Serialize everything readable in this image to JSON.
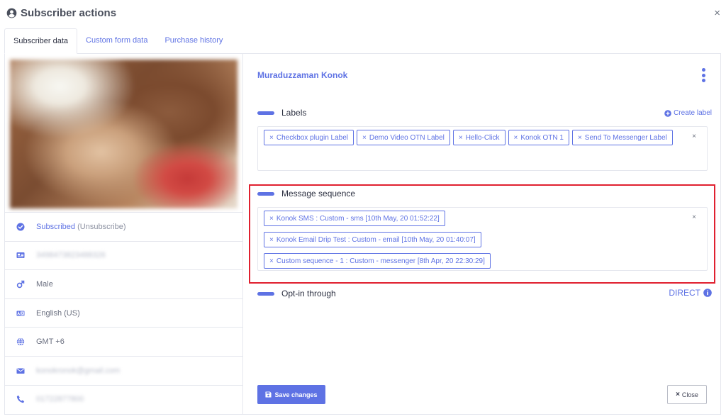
{
  "modal": {
    "title": "Subscriber actions",
    "close_symbol": "×"
  },
  "tabs": [
    {
      "label": "Subscriber data",
      "active": true
    },
    {
      "label": "Custom form data",
      "active": false
    },
    {
      "label": "Purchase history",
      "active": false
    }
  ],
  "profile": {
    "status": "Subscribed",
    "unsubscribe": "(Unsubscribe)",
    "id_number": "3498473823488326",
    "gender": "Male",
    "locale": "English (US)",
    "timezone": "GMT +6",
    "email": "konokronok@gmail.com",
    "phone": "01722877800"
  },
  "subscriber_name": "Muraduzzaman Konok",
  "labels": {
    "heading": "Labels",
    "create_label": "Create label",
    "tags": [
      "Checkbox plugin Label",
      "Demo Video OTN Label",
      "Hello-Click",
      "Konok OTN 1",
      "Send To Messenger Label"
    ]
  },
  "message_sequence": {
    "heading": "Message sequence",
    "tags": [
      "Konok SMS : Custom - sms [10th May, 20 01:52:22]",
      "Konok Email Drip Test : Custom - email [10th May, 20 01:40:07]",
      "Custom sequence - 1 : Custom - messenger [8th Apr, 20 22:30:29]"
    ]
  },
  "opt_in": {
    "heading": "Opt-in through",
    "value": "DIRECT"
  },
  "buttons": {
    "save": "Save changes",
    "close": "Close"
  },
  "colors": {
    "accent": "#5e72e4",
    "highlight": "#e0202f",
    "border": "#e5e7ee"
  },
  "icons": [
    "user-circle-icon",
    "check-circle-icon",
    "id-card-icon",
    "male-icon",
    "language-icon",
    "globe-icon",
    "envelope-icon",
    "phone-icon",
    "plus-circle-icon",
    "kebab-icon",
    "info-circle-icon",
    "save-icon"
  ]
}
